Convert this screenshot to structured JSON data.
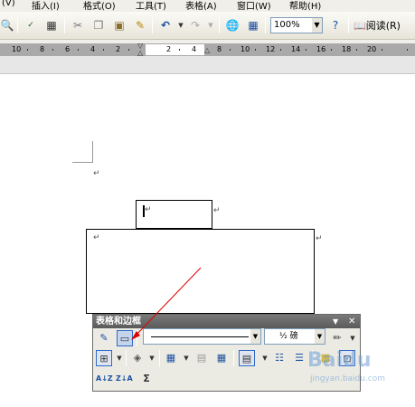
{
  "menubar": {
    "items": [
      {
        "label": "(V)"
      },
      {
        "label": "插入(I)"
      },
      {
        "label": "格式(O)"
      },
      {
        "label": "工具(T)"
      },
      {
        "label": "表格(A)"
      },
      {
        "label": "窗口(W)"
      },
      {
        "label": "帮助(H)"
      }
    ]
  },
  "toolbar": {
    "zoom": "100%",
    "read_label": "阅读(R)",
    "icons": [
      "print-preview-icon",
      "spelling-icon",
      "research-icon",
      "cut-icon",
      "copy-icon",
      "paste-icon",
      "format-painter-icon",
      "undo-icon",
      "redo-icon",
      "hyperlink-icon",
      "tables-borders-icon",
      "help-icon",
      "read-icon"
    ]
  },
  "ruler": {
    "left_ticks": [
      "10",
      "8",
      "6",
      "4",
      "2"
    ],
    "inner_ticks": [
      "2",
      "4"
    ],
    "right_ticks": [
      "8",
      "10",
      "12",
      "14",
      "16",
      "18",
      "20"
    ]
  },
  "document": {
    "para_mark": "↵",
    "cell_mark": "↵"
  },
  "tables_borders_toolbar": {
    "title": "表格和边框",
    "line_weight": "½ 磅",
    "sum_label": "Σ",
    "sort_asc": "A↓Z",
    "sort_desc": "Z↓A"
  },
  "watermark": {
    "brand": "Baidu",
    "sub": "jingyan.baidu.com"
  },
  "colors": {
    "accent": "#316ac5",
    "annotation": "#e00000",
    "title_bar": "#6a6a6a"
  }
}
